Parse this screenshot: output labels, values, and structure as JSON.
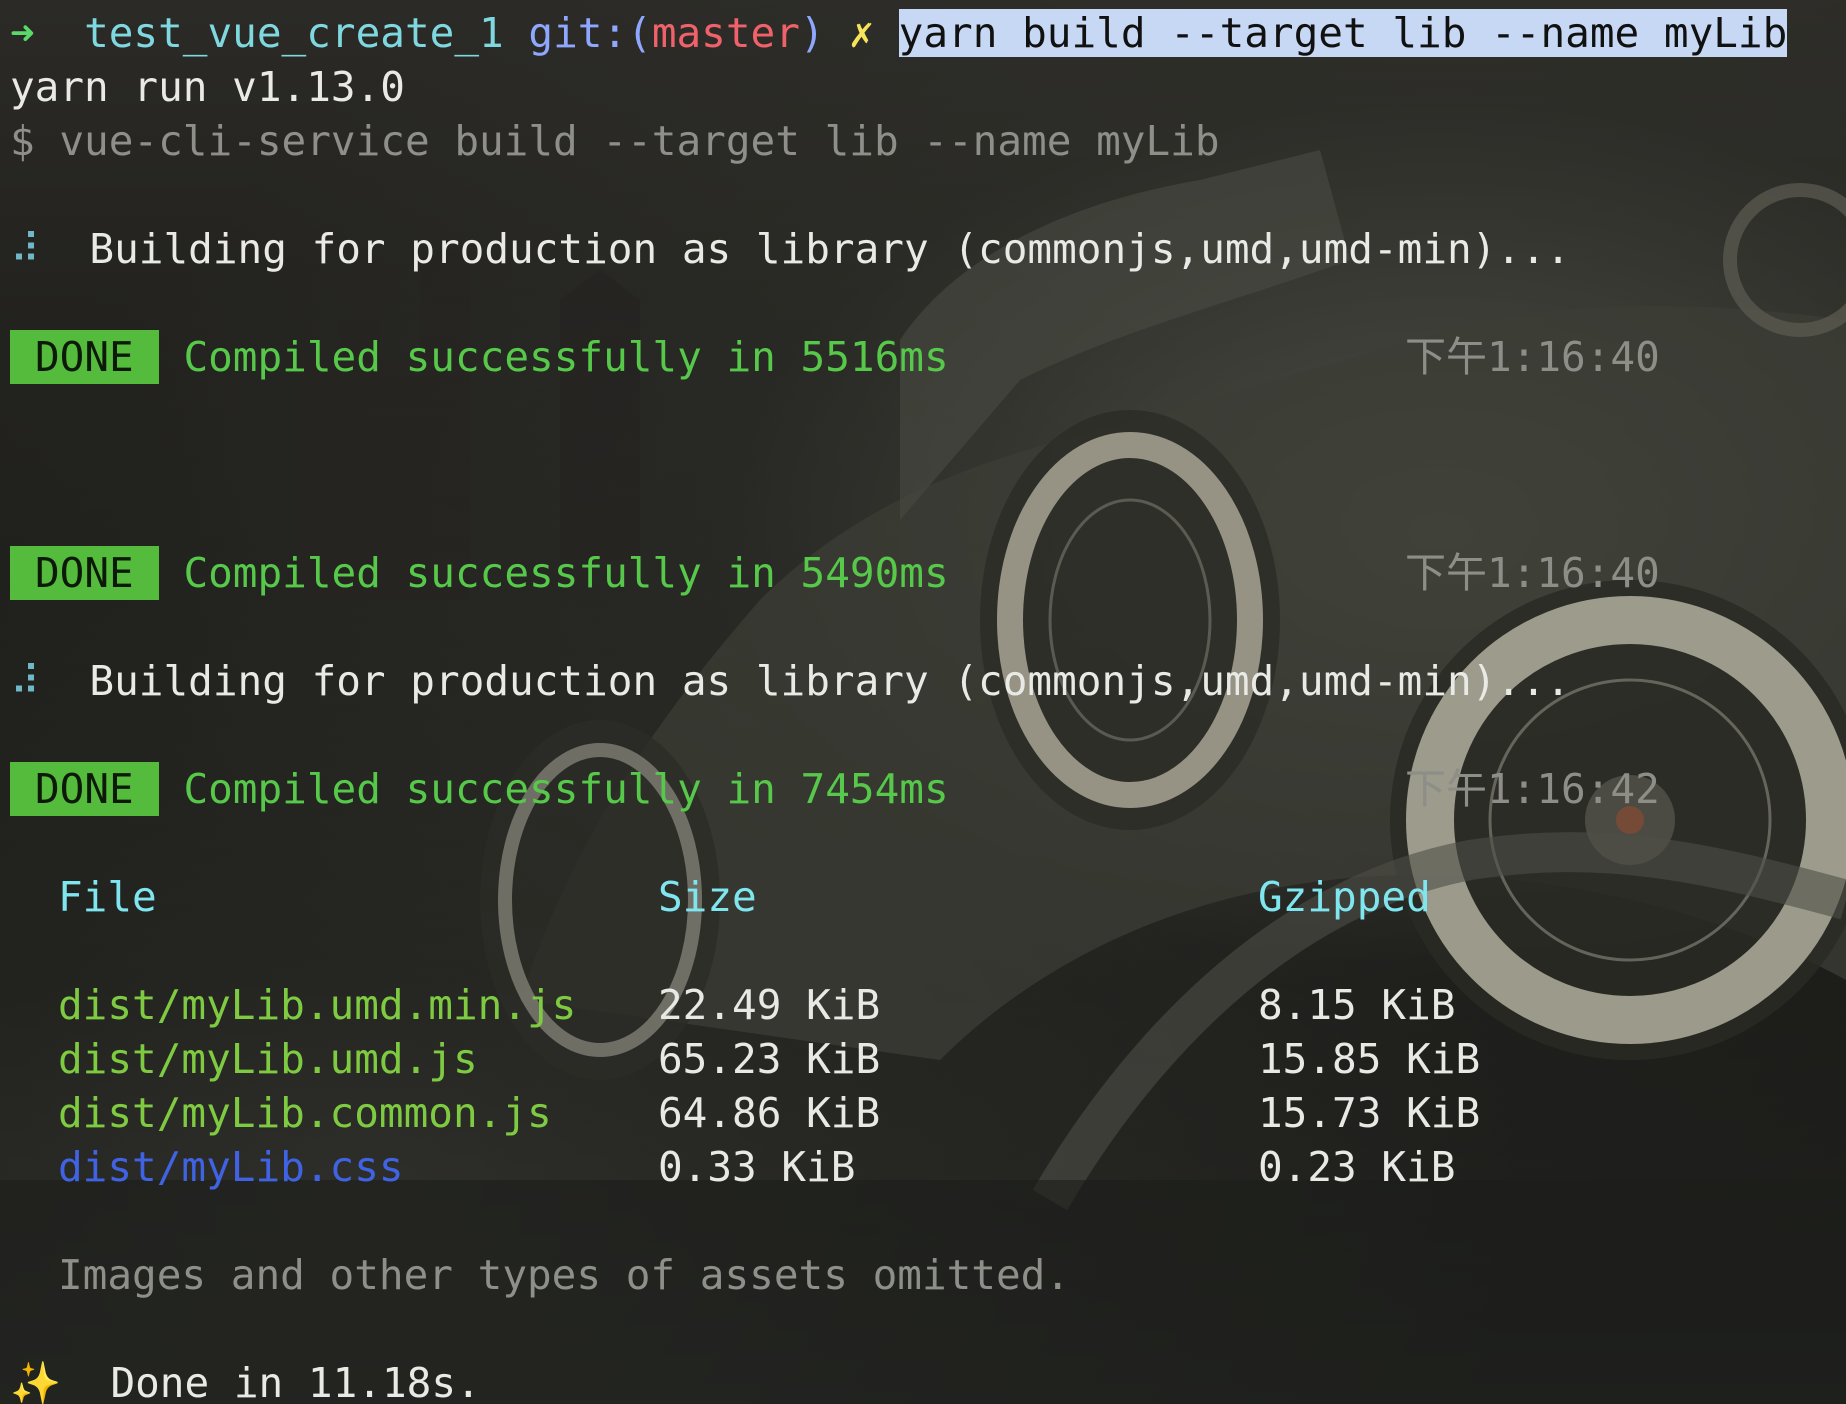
{
  "prompt": {
    "arrow": "➜",
    "directory": "test_vue_create_1",
    "git_label": "git:(",
    "branch": "master",
    "git_close": ")",
    "dirty_mark": "✗",
    "command": "yarn build --target lib --name myLib"
  },
  "output": {
    "yarn_version": "yarn run v1.13.0",
    "exec_line": "$ vue-cli-service build --target lib --name myLib",
    "spinner": "⠼",
    "building_1": "Building for production as library (commonjs,umd,umd-min)...",
    "building_2": "Building for production as library (commonjs,umd,umd-min)...",
    "done_label": "DONE",
    "compiled_1": "Compiled successfully in 5516ms",
    "compiled_2": "Compiled successfully in 5490ms",
    "compiled_3": "Compiled successfully in 7454ms",
    "time_1": "下午1:16:40",
    "time_2": "下午1:16:40",
    "time_3": "下午1:16:42"
  },
  "table": {
    "headers": [
      "File",
      "Size",
      "Gzipped"
    ],
    "rows": [
      {
        "file": "dist/myLib.umd.min.js",
        "size": "22.49 KiB",
        "gzipped": "8.15 KiB"
      },
      {
        "file": "dist/myLib.umd.js",
        "size": "65.23 KiB",
        "gzipped": "15.85 KiB"
      },
      {
        "file": "dist/myLib.common.js",
        "size": "64.86 KiB",
        "gzipped": "15.73 KiB"
      },
      {
        "file": "dist/myLib.css",
        "size": "0.33 KiB",
        "gzipped": "0.23 KiB"
      }
    ],
    "note": "Images and other types of assets omitted."
  },
  "footer": {
    "sparkle": "✨",
    "done_text": "Done in 11.18s."
  },
  "colors": {
    "done_badge": "#55bb3c",
    "success_text": "#57c94a",
    "selection": "#c7d8f5",
    "css_file": "#3f63e2"
  }
}
